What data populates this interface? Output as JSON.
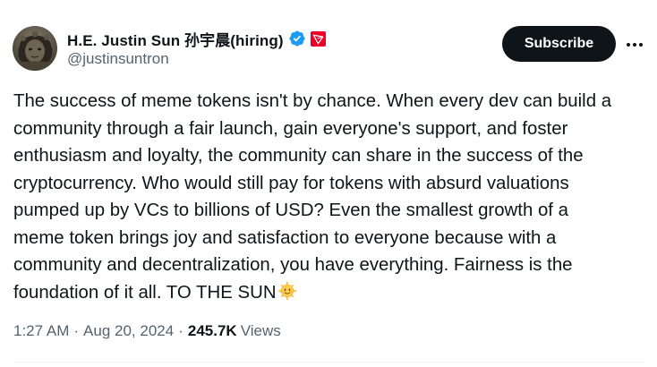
{
  "author": {
    "display_name": "H.E. Justin Sun 孙宇晨(hiring)",
    "handle": "@justinsuntron",
    "verified_icon": "verified-badge-icon",
    "affiliate_icon": "tron-logo-icon"
  },
  "actions": {
    "subscribe_label": "Subscribe",
    "more_icon": "more-horizontal-icon"
  },
  "tweet": {
    "text": "The success of meme tokens isn't by chance. When every dev can build a\ncommunity through a fair launch, gain everyone's support, and foster\nenthusiasm and loyalty, the community can share in the success of the\ncryptocurrency. Who would still pay for tokens with absurd valuations\npumped up by VCs to billions of USD? Even the smallest growth of a\nmeme token brings joy and satisfaction to everyone because with a\ncommunity and decentralization, you have everything. Fairness is the\nfoundation of it all. TO THE SUN",
    "emoji_icon": "sun-with-face-icon"
  },
  "meta": {
    "time": "1:27 AM",
    "separator": "·",
    "date": "Aug 20, 2024",
    "view_count": "245.7K",
    "views_label": "Views"
  },
  "colors": {
    "primary_text": "#0f1419",
    "secondary_text": "#536471",
    "verified_blue": "#1d9bf0",
    "tron_red": "#eb0029",
    "button_bg": "#0f1419"
  }
}
